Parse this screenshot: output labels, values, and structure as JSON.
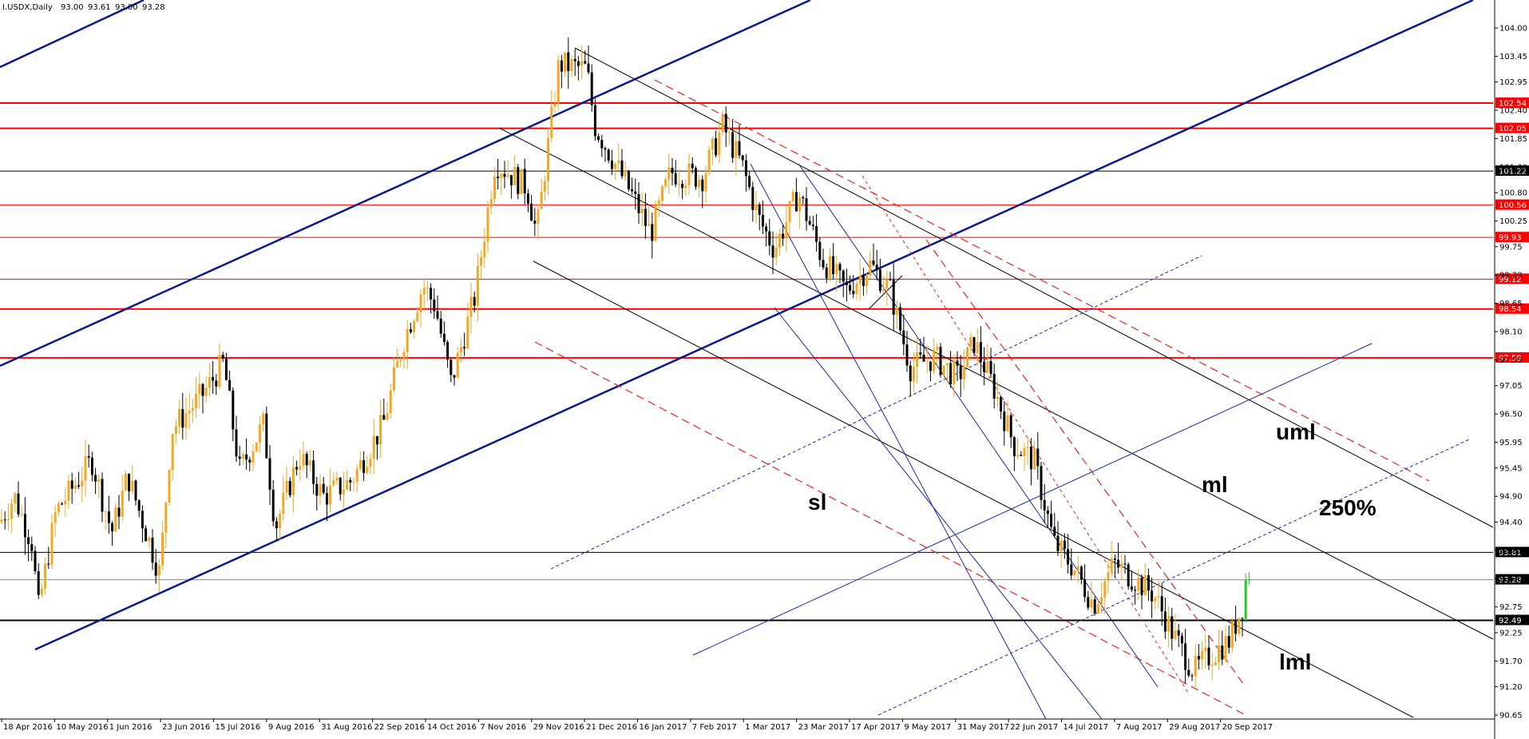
{
  "chart_data": {
    "type": "candlestick",
    "title": "I.USDX,Daily",
    "ohlc_header": {
      "open": "93.00",
      "high": "93.61",
      "low": "93.00",
      "close": "93.28"
    },
    "ylim": [
      90.65,
      104.2
    ],
    "price_ticks": [
      "104.00",
      "103.45",
      "102.95",
      "102.40",
      "101.85",
      "101.30",
      "100.80",
      "100.25",
      "99.75",
      "99.20",
      "98.65",
      "98.10",
      "97.55",
      "97.05",
      "96.50",
      "95.95",
      "95.45",
      "94.90",
      "94.40",
      "93.85",
      "93.30",
      "92.75",
      "92.25",
      "91.70",
      "91.20",
      "90.65"
    ],
    "date_ticks": [
      "18 Apr 2016",
      "10 May 2016",
      "1 Jun 2016",
      "23 Jun 2016",
      "15 Jul 2016",
      "9 Aug 2016",
      "31 Aug 2016",
      "22 Sep 2016",
      "14 Oct 2016",
      "7 Nov 2016",
      "29 Nov 2016",
      "21 Dec 2016",
      "16 Jan 2017",
      "7 Feb 2017",
      "1 Mar 2017",
      "23 Mar 2017",
      "17 Apr 2017",
      "9 May 2017",
      "31 May 2017",
      "22 Jun 2017",
      "14 Jul 2017",
      "7 Aug 2017",
      "29 Aug 2017",
      "20 Sep 2017"
    ],
    "levels": [
      {
        "label": "102.54",
        "value": 102.54,
        "color": "#ff0000",
        "tag_bg": "#ff0000",
        "tag_fg": "#ffffff",
        "weight": 2
      },
      {
        "label": "102.05",
        "value": 102.05,
        "color": "#ff0000",
        "tag_bg": "#ff0000",
        "tag_fg": "#ffffff",
        "weight": 2
      },
      {
        "label": "101.22",
        "value": 101.22,
        "color": "#000000",
        "tag_bg": "#000000",
        "tag_fg": "#ffffff",
        "weight": 1
      },
      {
        "label": "100.56",
        "value": 100.56,
        "color": "#ff0000",
        "tag_bg": "#ff0000",
        "tag_fg": "#ffffff",
        "weight": 1
      },
      {
        "label": "99.93",
        "value": 99.93,
        "color": "#ff0000",
        "tag_bg": "#ff0000",
        "tag_fg": "#ffffff",
        "weight": 1
      },
      {
        "label": "99.12",
        "value": 99.12,
        "color": "#ff0000",
        "tag_bg": "#ff0000",
        "tag_fg": "#ffffff",
        "weight": 1
      },
      {
        "label": "98.54",
        "value": 98.54,
        "color": "#ff0000",
        "tag_bg": "#ff0000",
        "tag_fg": "#ffffff",
        "weight": 2
      },
      {
        "label": "97.59",
        "value": 97.59,
        "color": "#ff0000",
        "tag_bg": "#ff0000",
        "tag_fg": "#ffffff",
        "weight": 2
      },
      {
        "label": "93.81",
        "value": 93.81,
        "color": "#000000",
        "tag_bg": "#000000",
        "tag_fg": "#ffffff",
        "weight": 1
      },
      {
        "label": "93.28",
        "value": 93.28,
        "color": "#6e8fb5",
        "tag_bg": "#000000",
        "tag_fg": "#ffffff",
        "weight": 1
      },
      {
        "label": "92.49",
        "value": 92.49,
        "color": "#000000",
        "tag_bg": "#000000",
        "tag_fg": "#ffffff",
        "weight": 2
      }
    ],
    "annotations": [
      "uml",
      "ml",
      "250%",
      "sl",
      "lml"
    ],
    "candle_colors": {
      "up": "#f5a623",
      "down": "#000000",
      "last": "#22cc22"
    },
    "grid": false
  }
}
